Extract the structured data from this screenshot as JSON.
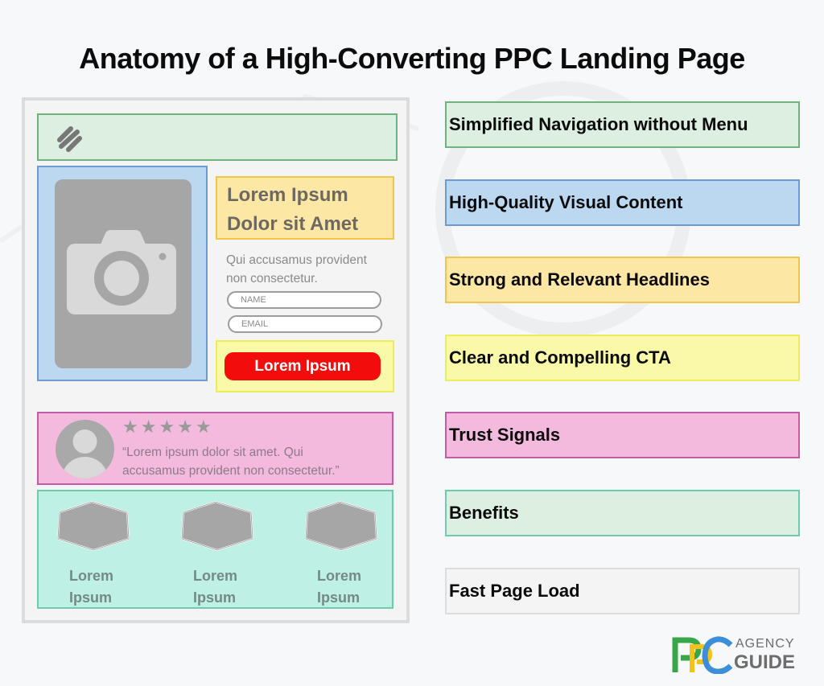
{
  "title": "Anatomy of a High-Converting PPC Landing Page",
  "mockup": {
    "navigation": {
      "icon": "slash-lines-logo-icon"
    },
    "visual": {
      "icon": "camera-icon"
    },
    "headline": {
      "line1": "Lorem Ipsum",
      "line2": "Dolor sit Amet"
    },
    "subtext": {
      "line1": "Qui accusamus provident",
      "line2": "non consectetur."
    },
    "form": {
      "name_placeholder": "NAME",
      "email_placeholder": "EMAIL",
      "cta_label": "Lorem Ipsum"
    },
    "testimonial": {
      "rating": 5,
      "rating_max": 5,
      "avatar_icon": "user-avatar-icon",
      "quote_line1": "“Lorem ipsum dolor sit amet. Qui",
      "quote_line2": "accusamus provident non consectetur.”"
    },
    "benefits": [
      {
        "line1": "Lorem",
        "line2": "Ipsum",
        "icon": "hexagon-icon"
      },
      {
        "line1": "Lorem",
        "line2": "Ipsum",
        "icon": "hexagon-icon"
      },
      {
        "line1": "Lorem",
        "line2": "Ipsum",
        "icon": "hexagon-icon"
      }
    ]
  },
  "legend": [
    {
      "label": "Simplified Navigation without Menu",
      "bg": "#dcefe0",
      "border": "#6fb27d"
    },
    {
      "label": "High-Quality Visual Content",
      "bg": "#bcd8f1",
      "border": "#6a9cd0"
    },
    {
      "label": "Strong and Relevant Headlines",
      "bg": "#fde7a4",
      "border": "#f0c64a"
    },
    {
      "label": "Clear and Compelling CTA",
      "bg": "#f9f9a8",
      "border": "#ecec5d"
    },
    {
      "label": "Trust Signals",
      "bg": "#f4bade",
      "border": "#c15aa7"
    },
    {
      "label": "Benefits",
      "bg": "#dcefe0",
      "border": "#6dccaa"
    },
    {
      "label": "Fast Page Load",
      "bg": "#f4f4f5",
      "border": "#dcdcdd"
    }
  ],
  "logo": {
    "mark": "PPC",
    "line1": "AGENCY",
    "line2": "GUIDE",
    "colors": {
      "green": "#3aa64a",
      "yellow": "#f2c21b",
      "blue": "#3b8fd9",
      "gray": "#6d6d6d"
    }
  }
}
